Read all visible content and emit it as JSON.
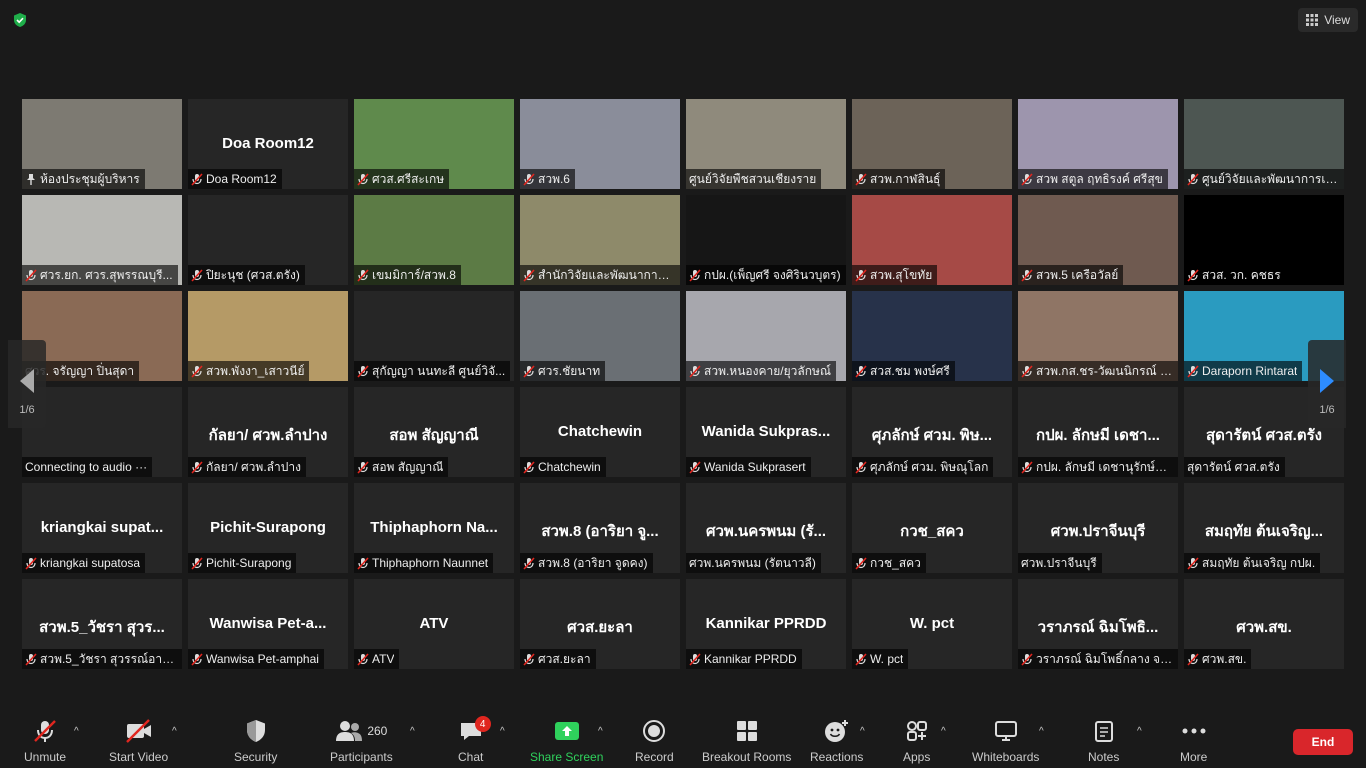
{
  "top_bar": {
    "view_label": "View"
  },
  "tiles": [
    {
      "center": "",
      "label": "ห้องประชุมผู้บริหาร",
      "icon": "pin",
      "bg": "#7d7a72"
    },
    {
      "center": "Doa Room12",
      "label": "Doa Room12",
      "icon": "muted",
      "bg": ""
    },
    {
      "center": "",
      "label": "ศวส.ศรีสะเกษ",
      "icon": "muted",
      "bg": "#5f8a4c"
    },
    {
      "center": "",
      "label": "สวพ.6",
      "icon": "muted",
      "bg": "#8a8d9a"
    },
    {
      "center": "",
      "label": "ศูนย์วิจัยพืชสวนเชียงราย",
      "icon": "none",
      "bg": "#8f8a7c"
    },
    {
      "center": "",
      "label": "สวพ.กาฬสินธุ์",
      "icon": "muted",
      "bg": "#6c6358"
    },
    {
      "center": "",
      "label": "สวพ สตูล ฤทธิรงค์ ศรีสุข",
      "icon": "muted",
      "bg": "#9d95ad"
    },
    {
      "center": "",
      "label": "ศูนย์วิจัยและพัฒนาการเก...",
      "icon": "muted",
      "bg": "#4d5652"
    },
    {
      "center": "",
      "label": "ศวร.ยก. ศวร.สุพรรณบุรี...",
      "icon": "muted",
      "bg": "#b8b8b4"
    },
    {
      "center": "",
      "label": "ปิยะนุช (ศวส.ตรัง)",
      "icon": "muted",
      "bg": ""
    },
    {
      "center": "",
      "label": "เขมมิการ์/สวพ.8",
      "icon": "muted",
      "bg": "#5c7b45"
    },
    {
      "center": "",
      "label": "สำนักวิจัยและพัฒนาการเ...",
      "icon": "muted",
      "bg": "#8e8a6a"
    },
    {
      "center": "",
      "label": "กปผ.(เพ็ญศรี จงศิรินวบุตร)",
      "icon": "muted",
      "bg": "#161616"
    },
    {
      "center": "",
      "label": "สวพ.สุโขทัย",
      "icon": "muted",
      "bg": "#a64a46"
    },
    {
      "center": "",
      "label": "สวพ.5 เครือวัลย์",
      "icon": "muted",
      "bg": "#6f5a50"
    },
    {
      "center": "",
      "label": "สวส. วก. คชธร",
      "icon": "muted",
      "bg": "#000000"
    },
    {
      "center": "",
      "label": "ศวร. จรัญญา ปิ่นสุดา",
      "icon": "none",
      "bg": "#8a6a55"
    },
    {
      "center": "",
      "label": "สวพ.พังงา_เสาวนีย์",
      "icon": "muted",
      "bg": "#b59a66"
    },
    {
      "center": "",
      "label": "สุกัญญา นนทะลี ศูนย์วิจั...",
      "icon": "muted",
      "bg": ""
    },
    {
      "center": "",
      "label": "ศวร.ชัยนาท",
      "icon": "muted",
      "bg": "#6a6f74"
    },
    {
      "center": "",
      "label": "สวพ.หนองคาย/ยุวลักษณ์",
      "icon": "muted",
      "bg": "#a7a7ad"
    },
    {
      "center": "",
      "label": "สวส.ชม พงษ์ศรี",
      "icon": "muted",
      "bg": "#27324a"
    },
    {
      "center": "",
      "label": "สวพ.กส.ชร-วัฒนนิกรณ์ เ...",
      "icon": "muted",
      "bg": "#8f7565"
    },
    {
      "center": "",
      "label": "Daraporn Rintarat",
      "icon": "muted",
      "bg": "#2a9bc0"
    },
    {
      "center": "",
      "label": "Connecting to audio ···",
      "icon": "none",
      "bg": ""
    },
    {
      "center": "กัลยา/ ศวพ.ลำปาง",
      "label": "กัลยา/ ศวพ.ลำปาง",
      "icon": "muted",
      "bg": ""
    },
    {
      "center": "สอพ สัญญาณี",
      "label": "สอพ สัญญาณี",
      "icon": "muted",
      "bg": ""
    },
    {
      "center": "Chatchewin",
      "label": "Chatchewin",
      "icon": "muted",
      "bg": ""
    },
    {
      "center": "Wanida Sukpras...",
      "label": "Wanida Sukprasert",
      "icon": "muted",
      "bg": ""
    },
    {
      "center": "ศุภลักษ์ ศวม. พิษ...",
      "label": "ศุภลักษ์ ศวม. พิษณุโลก",
      "icon": "muted",
      "bg": ""
    },
    {
      "center": "กปผ. ลักษมี เดชา...",
      "label": "กปผ. ลักษมี เดชานุรักษ์นุ...",
      "icon": "muted",
      "bg": ""
    },
    {
      "center": "สุดารัตน์ ศวส.ตรัง",
      "label": "สุดารัตน์ ศวส.ตรัง",
      "icon": "none",
      "bg": ""
    },
    {
      "center": "kriangkai supat...",
      "label": "kriangkai supatosa",
      "icon": "muted",
      "bg": ""
    },
    {
      "center": "Pichit-Surapong",
      "label": "Pichit-Surapong",
      "icon": "muted",
      "bg": ""
    },
    {
      "center": "Thiphaphorn Na...",
      "label": "Thiphaphorn Naunnet",
      "icon": "muted",
      "bg": ""
    },
    {
      "center": "สวพ.8 (อาริยา จู...",
      "label": "สวพ.8 (อาริยา จูดคง)",
      "icon": "muted",
      "bg": ""
    },
    {
      "center": "ศวพ.นครพนม (รั...",
      "label": "ศวพ.นครพนม (รัตนาวลี)",
      "icon": "none",
      "bg": ""
    },
    {
      "center": "กวช_สคว",
      "label": "กวช_สคว",
      "icon": "muted",
      "bg": ""
    },
    {
      "center": "ศวพ.ปราจีนบุรี",
      "label": "ศวพ.ปราจีนบุรี",
      "icon": "none",
      "bg": ""
    },
    {
      "center": "สมฤทัย ต้นเจริญ...",
      "label": "สมฤทัย ต้นเจริญ กปผ.",
      "icon": "muted",
      "bg": ""
    },
    {
      "center": "สวพ.5_วัชรา สุวร...",
      "label": "สวพ.5_วัชรา สุวรรณ์อาสน์",
      "icon": "muted",
      "bg": ""
    },
    {
      "center": "Wanwisa Pet-a...",
      "label": "Wanwisa Pet-amphai",
      "icon": "muted",
      "bg": ""
    },
    {
      "center": "ATV",
      "label": "ATV",
      "icon": "muted",
      "bg": ""
    },
    {
      "center": "ศวส.ยะลา",
      "label": "ศวส.ยะลา",
      "icon": "muted",
      "bg": ""
    },
    {
      "center": "Kannikar PPRDD",
      "label": "Kannikar PPRDD",
      "icon": "muted",
      "bg": ""
    },
    {
      "center": "W. pct",
      "label": "W. pct",
      "icon": "muted",
      "bg": ""
    },
    {
      "center": "วราภรณ์ ฉิมโพธิ...",
      "label": "วราภรณ์ ฉิมโพธิ์กลาง จน...",
      "icon": "muted",
      "bg": ""
    },
    {
      "center": "ศวพ.สข.",
      "label": "ศวพ.สข.",
      "icon": "muted",
      "bg": ""
    }
  ],
  "pagination": {
    "left": "1/6",
    "right": "1/6"
  },
  "toolbar": {
    "unmute": "Unmute",
    "start_video": "Start Video",
    "security": "Security",
    "participants": "Participants",
    "participants_count": "260",
    "chat": "Chat",
    "chat_badge": "4",
    "share_screen": "Share Screen",
    "record": "Record",
    "breakout_rooms": "Breakout Rooms",
    "reactions": "Reactions",
    "apps": "Apps",
    "whiteboards": "Whiteboards",
    "notes": "Notes",
    "more": "More",
    "end": "End"
  },
  "colors": {
    "background": "#1a1a1a",
    "tile": "#262626",
    "mute_red": "#e0261f",
    "share_green": "#2fd15c",
    "end_red": "#d9262b"
  }
}
